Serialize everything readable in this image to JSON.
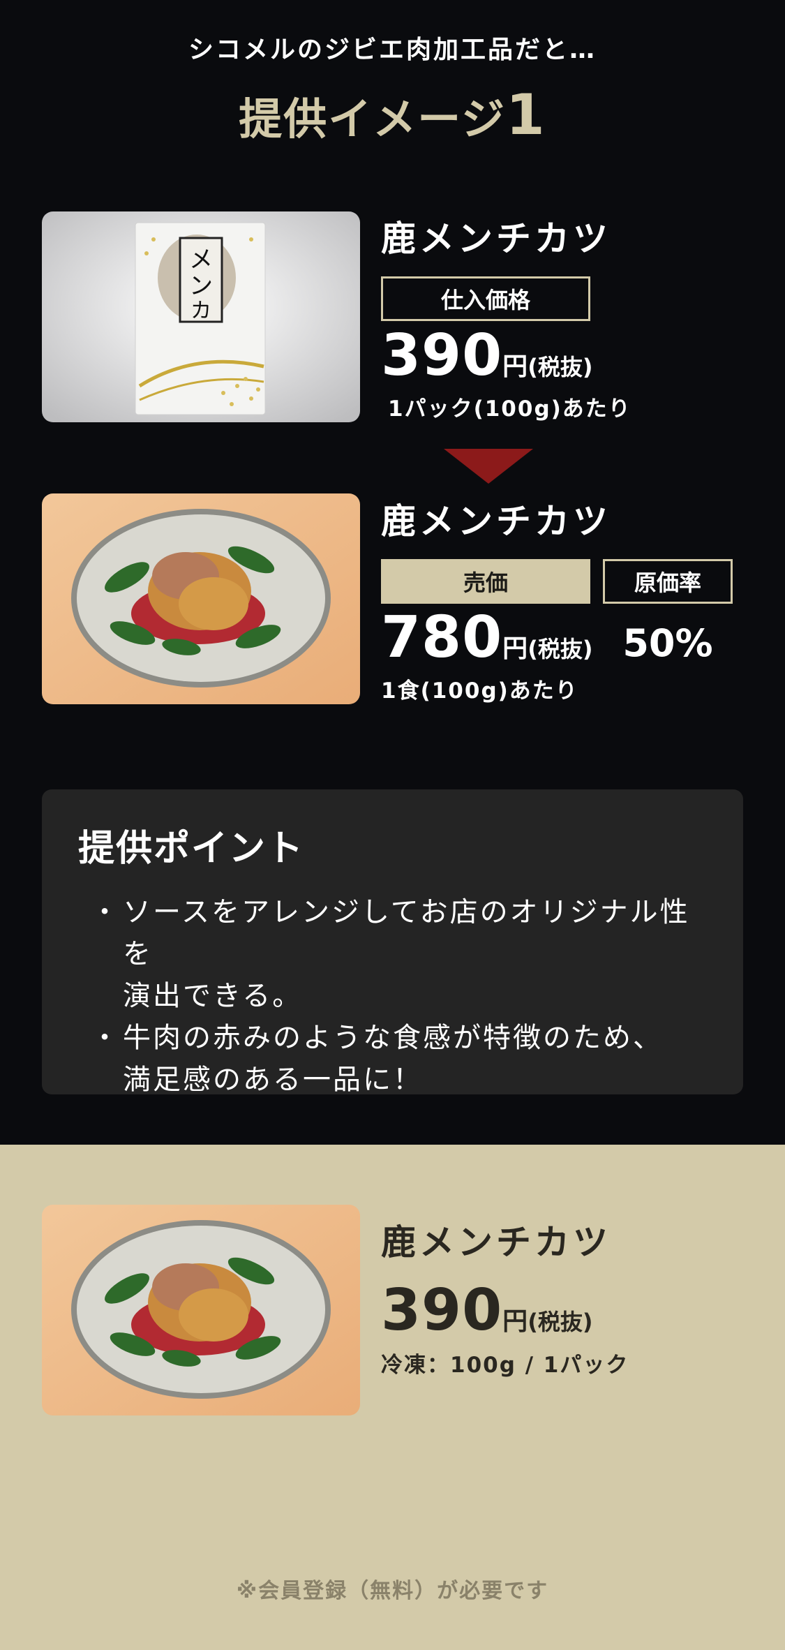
{
  "header": {
    "intro": "シコメルのジビエ肉加工品だと…",
    "headline": "提供イメージ",
    "headline_num": "1"
  },
  "purchase": {
    "image": "packaged-venison-menchi-katsu",
    "name": "鹿メンチカツ",
    "label": "仕入価格",
    "price": "390",
    "unit": "円",
    "tax": "(税抜)",
    "per": "1パック(100g)あたり"
  },
  "serving": {
    "image": "plated-venison-menchi-katsu",
    "name": "鹿メンチカツ",
    "label": "売価",
    "ratio_label": "原価率",
    "price": "780",
    "unit": "円",
    "tax": "(税抜)",
    "ratio": "50%",
    "per": "1食(100g)あたり"
  },
  "points": {
    "title": "提供ポイント",
    "items": [
      {
        "bullet": "・",
        "line1": "ソースをアレンジしてお店のオリジナル性を",
        "line2": "演出できる。"
      },
      {
        "bullet": "・",
        "line1": "牛肉の赤みのような食感が特徴のため、",
        "line2": "満足感のある一品に！"
      }
    ]
  },
  "product": {
    "image": "plated-venison-menchi-katsu",
    "name": "鹿メンチカツ",
    "price": "390",
    "unit": "円",
    "tax": "(税抜)",
    "spec": "冷凍：100g / 1パック"
  },
  "footer": {
    "note": "※会員登録（無料）が必要です"
  },
  "colors": {
    "background": "#0a0b0e",
    "accent_beige": "#d3caa9",
    "arrow_red": "#8c1a1a",
    "card": "#242424"
  }
}
